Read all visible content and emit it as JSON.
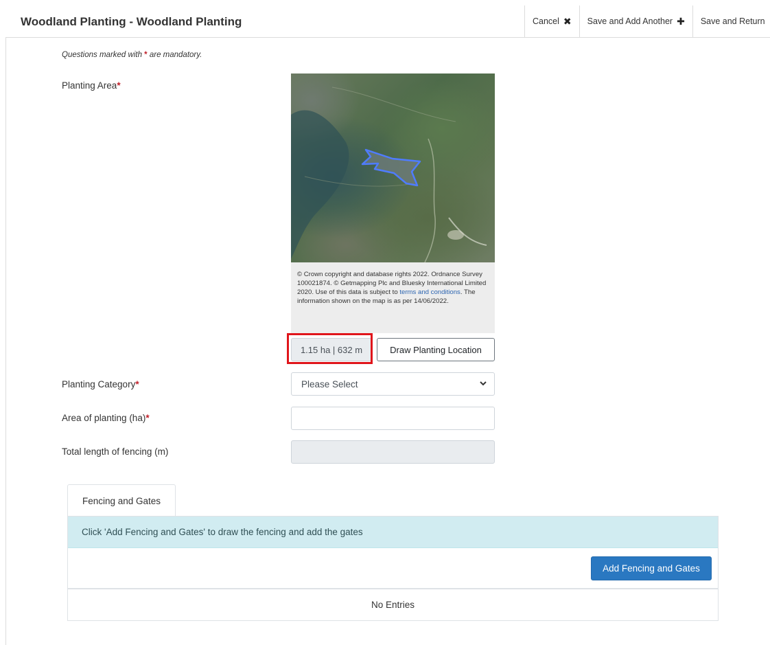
{
  "header": {
    "title": "Woodland Planting - Woodland Planting",
    "actions": {
      "cancel": "Cancel",
      "save_add": "Save and Add Another",
      "save_return": "Save and Return"
    }
  },
  "form": {
    "mandatory_note_prefix": "Questions marked with ",
    "mandatory_note_suffix": " are mandatory.",
    "required_marker": "*",
    "planting_area_label": "Planting Area",
    "planting_category_label": "Planting Category",
    "area_of_planting_label": "Area of planting (ha)",
    "fencing_length_label": "Total length of fencing (m)",
    "planting_category_value": "Please Select",
    "area_of_planting_value": "",
    "fencing_length_value": ""
  },
  "map": {
    "caption_part1": "© Crown copyright and database rights 2022. Ordnance Survey 100021874. © Getmapping Plc and Bluesky International Limited 2020. Use of this data is subject to ",
    "caption_link": "terms and conditions",
    "caption_part2": ". The information shown on the map is as per 14/06/2022.",
    "measurement": "1.15 ha | 632 m",
    "draw_button": "Draw Planting Location"
  },
  "fencing": {
    "tab_label": "Fencing and Gates",
    "info_text": "Click 'Add Fencing and Gates' to draw the fencing and add the gates",
    "add_button": "Add Fencing and Gates",
    "empty_text": "No Entries"
  },
  "colors": {
    "primary_button": "#2a78c1",
    "info_background": "#d1ecf1",
    "required": "#c0202a",
    "highlight": "#e0151b",
    "polygon_outline": "#4f7cff"
  },
  "icons": {
    "cancel": "close-icon",
    "save_add": "plus-icon",
    "select": "chevron-down-icon"
  }
}
